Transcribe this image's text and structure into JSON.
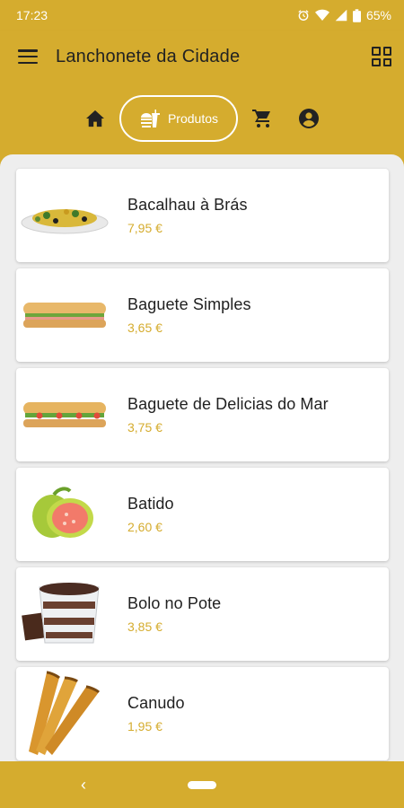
{
  "status": {
    "time": "17:23",
    "battery": "65%"
  },
  "app": {
    "title": "Lanchonete da Cidade"
  },
  "nav": {
    "active_label": "Produtos"
  },
  "products": [
    {
      "name": "Bacalhau à Brás",
      "price": "7,95 €"
    },
    {
      "name": "Baguete Simples",
      "price": "3,65 €"
    },
    {
      "name": "Baguete de Delicias do Mar",
      "price": "3,75 €"
    },
    {
      "name": "Batido",
      "price": "2,60 €"
    },
    {
      "name": "Bolo no Pote",
      "price": "3,85 €"
    },
    {
      "name": "Canudo",
      "price": "1,95 €"
    }
  ],
  "colors": {
    "brand": "#d5ac2e",
    "background": "#eeeeee",
    "card": "#ffffff",
    "text": "#212121"
  }
}
